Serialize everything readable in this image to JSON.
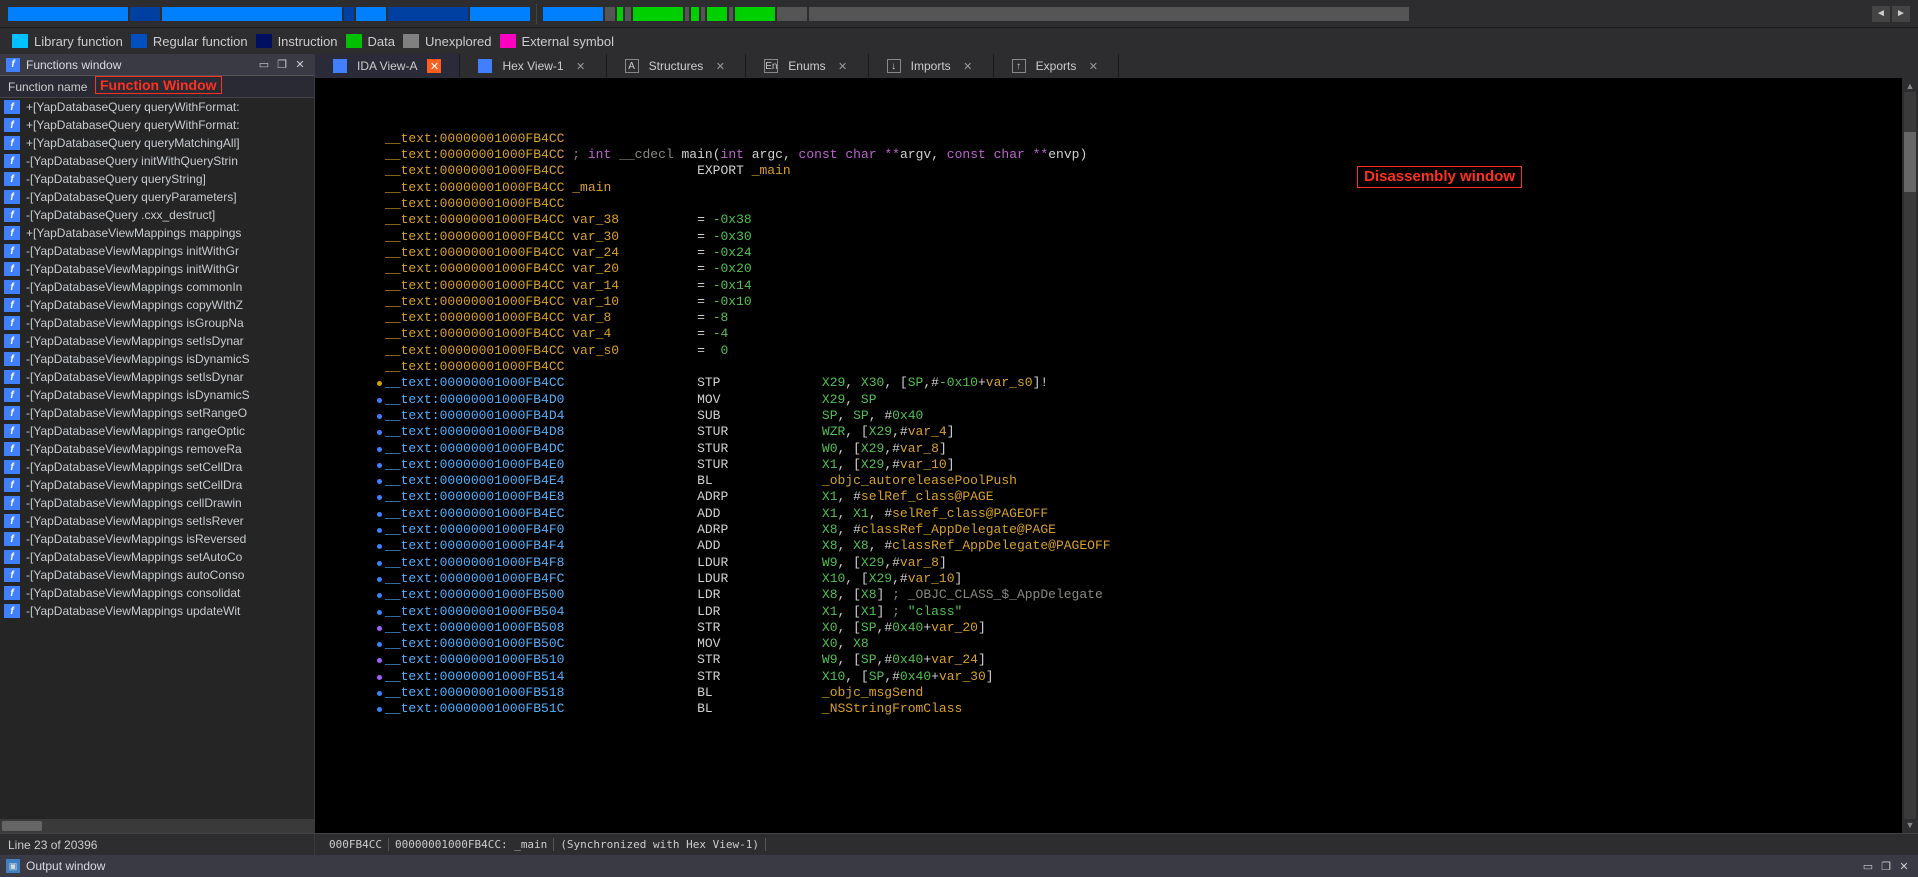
{
  "legend": [
    {
      "label": "Library function",
      "cls": "lg-cyan"
    },
    {
      "label": "Regular function",
      "cls": "lg-blue"
    },
    {
      "label": "Instruction",
      "cls": "lg-dblue"
    },
    {
      "label": "Data",
      "cls": "lg-green"
    },
    {
      "label": "Unexplored",
      "cls": "lg-gray"
    },
    {
      "label": "External symbol",
      "cls": "lg-pink"
    }
  ],
  "panels": {
    "functions_title": "Functions window",
    "output_title": "Output window",
    "function_window_annotation": "Function Window",
    "disasm_annotation": "Disassembly window",
    "column_header": "Function name"
  },
  "tabs": [
    {
      "label": "IDA View-A",
      "active": true,
      "icon": "ticon-blue",
      "close": "orange"
    },
    {
      "label": "Hex View-1",
      "active": false,
      "icon": "ticon-blue",
      "close": ""
    },
    {
      "label": "Structures",
      "active": false,
      "icon": "ticon-box",
      "iconText": "A",
      "close": ""
    },
    {
      "label": "Enums",
      "active": false,
      "icon": "ticon-box",
      "iconText": "En",
      "close": ""
    },
    {
      "label": "Imports",
      "active": false,
      "icon": "ticon-box",
      "iconText": "↓",
      "close": ""
    },
    {
      "label": "Exports",
      "active": false,
      "icon": "ticon-box",
      "iconText": "↑",
      "close": ""
    }
  ],
  "functions": [
    "+[YapDatabaseQuery queryWithFormat:",
    "+[YapDatabaseQuery queryWithFormat:",
    "+[YapDatabaseQuery queryMatchingAll]",
    "-[YapDatabaseQuery initWithQueryStrin",
    "-[YapDatabaseQuery queryString]",
    "-[YapDatabaseQuery queryParameters]",
    "-[YapDatabaseQuery .cxx_destruct]",
    "+[YapDatabaseViewMappings mappings",
    "-[YapDatabaseViewMappings initWithGr",
    "-[YapDatabaseViewMappings initWithGr",
    "-[YapDatabaseViewMappings commonIn",
    "-[YapDatabaseViewMappings copyWithZ",
    "-[YapDatabaseViewMappings isGroupNa",
    "-[YapDatabaseViewMappings setIsDynar",
    "-[YapDatabaseViewMappings isDynamicS",
    "-[YapDatabaseViewMappings setIsDynar",
    "-[YapDatabaseViewMappings isDynamicS",
    "-[YapDatabaseViewMappings setRangeO",
    "-[YapDatabaseViewMappings rangeOptic",
    "-[YapDatabaseViewMappings removeRa",
    "-[YapDatabaseViewMappings setCellDra",
    "-[YapDatabaseViewMappings setCellDra",
    "-[YapDatabaseViewMappings cellDrawin",
    "-[YapDatabaseViewMappings setIsRever",
    "-[YapDatabaseViewMappings isReversed",
    "-[YapDatabaseViewMappings setAutoCo",
    "-[YapDatabaseViewMappings autoConso",
    "-[YapDatabaseViewMappings consolidat",
    "-[YapDatabaseViewMappings updateWit"
  ],
  "status": {
    "left": "Line 23 of 20396",
    "right_cells": [
      "000FB4CC",
      "00000001000FB4CC: _main",
      "(Synchronized with Hex View-1)"
    ]
  },
  "disasm": [
    {
      "dot": "",
      "addr": "__text:00000001000FB4CC",
      "rest": ""
    },
    {
      "dot": "",
      "addr": "__text:00000001000FB4CC",
      "sig": "; int __cdecl main(int argc, const char **argv, const char **envp)"
    },
    {
      "dot": "",
      "addr": "__text:00000001000FB4CC",
      "export": "EXPORT _main"
    },
    {
      "dot": "",
      "addr": "__text:00000001000FB4CC",
      "label": "_main"
    },
    {
      "dot": "",
      "addr": "__text:00000001000FB4CC",
      "rest": ""
    },
    {
      "dot": "",
      "addr": "__text:00000001000FB4CC",
      "var": "var_38",
      "eq": "-0x38"
    },
    {
      "dot": "",
      "addr": "__text:00000001000FB4CC",
      "var": "var_30",
      "eq": "-0x30"
    },
    {
      "dot": "",
      "addr": "__text:00000001000FB4CC",
      "var": "var_24",
      "eq": "-0x24"
    },
    {
      "dot": "",
      "addr": "__text:00000001000FB4CC",
      "var": "var_20",
      "eq": "-0x20"
    },
    {
      "dot": "",
      "addr": "__text:00000001000FB4CC",
      "var": "var_14",
      "eq": "-0x14"
    },
    {
      "dot": "",
      "addr": "__text:00000001000FB4CC",
      "var": "var_10",
      "eq": "-0x10"
    },
    {
      "dot": "",
      "addr": "__text:00000001000FB4CC",
      "var": "var_8",
      "eq": "-8"
    },
    {
      "dot": "",
      "addr": "__text:00000001000FB4CC",
      "var": "var_4",
      "eq": "-4"
    },
    {
      "dot": "",
      "addr": "__text:00000001000FB4CC",
      "var": "var_s0",
      "eq": " 0"
    },
    {
      "dot": "",
      "addr": "__text:00000001000FB4CC",
      "rest": ""
    },
    {
      "dot": "y",
      "addrb": "__text:00000001000FB4CC",
      "mn": "STP",
      "ops": [
        {
          "t": "reg",
          "v": "X29"
        },
        {
          "t": "p",
          "v": ", "
        },
        {
          "t": "reg",
          "v": "X30"
        },
        {
          "t": "p",
          "v": ", ["
        },
        {
          "t": "reg",
          "v": "SP"
        },
        {
          "t": "p",
          "v": ",#"
        },
        {
          "t": "num",
          "v": "-0x10"
        },
        {
          "t": "p",
          "v": "+"
        },
        {
          "t": "varref",
          "v": "var_s0"
        },
        {
          "t": "p",
          "v": "]!"
        }
      ]
    },
    {
      "dot": "b",
      "addrb": "__text:00000001000FB4D0",
      "mn": "MOV",
      "ops": [
        {
          "t": "reg",
          "v": "X29"
        },
        {
          "t": "p",
          "v": ", "
        },
        {
          "t": "reg",
          "v": "SP"
        }
      ]
    },
    {
      "dot": "b",
      "addrb": "__text:00000001000FB4D4",
      "mn": "SUB",
      "ops": [
        {
          "t": "reg",
          "v": "SP"
        },
        {
          "t": "p",
          "v": ", "
        },
        {
          "t": "reg",
          "v": "SP"
        },
        {
          "t": "p",
          "v": ", #"
        },
        {
          "t": "num",
          "v": "0x40"
        }
      ]
    },
    {
      "dot": "b",
      "addrb": "__text:00000001000FB4D8",
      "mn": "STUR",
      "ops": [
        {
          "t": "reg",
          "v": "WZR"
        },
        {
          "t": "p",
          "v": ", ["
        },
        {
          "t": "reg",
          "v": "X29"
        },
        {
          "t": "p",
          "v": ",#"
        },
        {
          "t": "varref",
          "v": "var_4"
        },
        {
          "t": "p",
          "v": "]"
        }
      ]
    },
    {
      "dot": "b",
      "addrb": "__text:00000001000FB4DC",
      "mn": "STUR",
      "ops": [
        {
          "t": "reg",
          "v": "W0"
        },
        {
          "t": "p",
          "v": ", ["
        },
        {
          "t": "reg",
          "v": "X29"
        },
        {
          "t": "p",
          "v": ",#"
        },
        {
          "t": "varref",
          "v": "var_8"
        },
        {
          "t": "p",
          "v": "]"
        }
      ]
    },
    {
      "dot": "b",
      "addrb": "__text:00000001000FB4E0",
      "mn": "STUR",
      "ops": [
        {
          "t": "reg",
          "v": "X1"
        },
        {
          "t": "p",
          "v": ", ["
        },
        {
          "t": "reg",
          "v": "X29"
        },
        {
          "t": "p",
          "v": ",#"
        },
        {
          "t": "varref",
          "v": "var_10"
        },
        {
          "t": "p",
          "v": "]"
        }
      ]
    },
    {
      "dot": "b",
      "addrb": "__text:00000001000FB4E4",
      "mn": "BL",
      "ops": [
        {
          "t": "call",
          "v": "_objc_autoreleasePoolPush"
        }
      ]
    },
    {
      "dot": "b",
      "addrb": "__text:00000001000FB4E8",
      "mn": "ADRP",
      "ops": [
        {
          "t": "reg",
          "v": "X1"
        },
        {
          "t": "p",
          "v": ", #"
        },
        {
          "t": "call",
          "v": "selRef_class@PAGE"
        }
      ]
    },
    {
      "dot": "b",
      "addrb": "__text:00000001000FB4EC",
      "mn": "ADD",
      "ops": [
        {
          "t": "reg",
          "v": "X1"
        },
        {
          "t": "p",
          "v": ", "
        },
        {
          "t": "reg",
          "v": "X1"
        },
        {
          "t": "p",
          "v": ", #"
        },
        {
          "t": "call",
          "v": "selRef_class@PAGEOFF"
        }
      ]
    },
    {
      "dot": "b",
      "addrb": "__text:00000001000FB4F0",
      "mn": "ADRP",
      "ops": [
        {
          "t": "reg",
          "v": "X8"
        },
        {
          "t": "p",
          "v": ", #"
        },
        {
          "t": "call",
          "v": "classRef_AppDelegate@PAGE"
        }
      ]
    },
    {
      "dot": "b",
      "addrb": "__text:00000001000FB4F4",
      "mn": "ADD",
      "ops": [
        {
          "t": "reg",
          "v": "X8"
        },
        {
          "t": "p",
          "v": ", "
        },
        {
          "t": "reg",
          "v": "X8"
        },
        {
          "t": "p",
          "v": ", #"
        },
        {
          "t": "call",
          "v": "classRef_AppDelegate@PAGEOFF"
        }
      ]
    },
    {
      "dot": "b",
      "addrb": "__text:00000001000FB4F8",
      "mn": "LDUR",
      "ops": [
        {
          "t": "reg",
          "v": "W9"
        },
        {
          "t": "p",
          "v": ", ["
        },
        {
          "t": "reg",
          "v": "X29"
        },
        {
          "t": "p",
          "v": ",#"
        },
        {
          "t": "varref",
          "v": "var_8"
        },
        {
          "t": "p",
          "v": "]"
        }
      ]
    },
    {
      "dot": "b",
      "addrb": "__text:00000001000FB4FC",
      "mn": "LDUR",
      "ops": [
        {
          "t": "reg",
          "v": "X10"
        },
        {
          "t": "p",
          "v": ", ["
        },
        {
          "t": "reg",
          "v": "X29"
        },
        {
          "t": "p",
          "v": ",#"
        },
        {
          "t": "varref",
          "v": "var_10"
        },
        {
          "t": "p",
          "v": "]"
        }
      ]
    },
    {
      "dot": "b",
      "addrb": "__text:00000001000FB500",
      "mn": "LDR",
      "ops": [
        {
          "t": "reg",
          "v": "X8"
        },
        {
          "t": "p",
          "v": ", ["
        },
        {
          "t": "reg",
          "v": "X8"
        },
        {
          "t": "p",
          "v": "] "
        },
        {
          "t": "cmt",
          "v": "; _OBJC_CLASS_$_AppDelegate"
        }
      ]
    },
    {
      "dot": "b",
      "addrb": "__text:00000001000FB504",
      "mn": "LDR",
      "ops": [
        {
          "t": "reg",
          "v": "X1"
        },
        {
          "t": "p",
          "v": ", ["
        },
        {
          "t": "reg",
          "v": "X1"
        },
        {
          "t": "p",
          "v": "] "
        },
        {
          "t": "cmt",
          "v": "; "
        },
        {
          "t": "str",
          "v": "\"class\""
        }
      ]
    },
    {
      "dot": "p",
      "addrb": "__text:00000001000FB508",
      "mn": "STR",
      "ops": [
        {
          "t": "reg",
          "v": "X0"
        },
        {
          "t": "p",
          "v": ", ["
        },
        {
          "t": "reg",
          "v": "SP"
        },
        {
          "t": "p",
          "v": ",#"
        },
        {
          "t": "num",
          "v": "0x40"
        },
        {
          "t": "p",
          "v": "+"
        },
        {
          "t": "varref",
          "v": "var_20"
        },
        {
          "t": "p",
          "v": "]"
        }
      ]
    },
    {
      "dot": "b",
      "addrb": "__text:00000001000FB50C",
      "mn": "MOV",
      "ops": [
        {
          "t": "reg",
          "v": "X0"
        },
        {
          "t": "p",
          "v": ", "
        },
        {
          "t": "reg",
          "v": "X8"
        }
      ]
    },
    {
      "dot": "p",
      "addrb": "__text:00000001000FB510",
      "mn": "STR",
      "ops": [
        {
          "t": "reg",
          "v": "W9"
        },
        {
          "t": "p",
          "v": ", ["
        },
        {
          "t": "reg",
          "v": "SP"
        },
        {
          "t": "p",
          "v": ",#"
        },
        {
          "t": "num",
          "v": "0x40"
        },
        {
          "t": "p",
          "v": "+"
        },
        {
          "t": "varref",
          "v": "var_24"
        },
        {
          "t": "p",
          "v": "]"
        }
      ]
    },
    {
      "dot": "p",
      "addrb": "__text:00000001000FB514",
      "mn": "STR",
      "ops": [
        {
          "t": "reg",
          "v": "X10"
        },
        {
          "t": "p",
          "v": ", ["
        },
        {
          "t": "reg",
          "v": "SP"
        },
        {
          "t": "p",
          "v": ",#"
        },
        {
          "t": "num",
          "v": "0x40"
        },
        {
          "t": "p",
          "v": "+"
        },
        {
          "t": "varref",
          "v": "var_30"
        },
        {
          "t": "p",
          "v": "]"
        }
      ]
    },
    {
      "dot": "b",
      "addrb": "__text:00000001000FB518",
      "mn": "BL",
      "ops": [
        {
          "t": "call",
          "v": "_objc_msgSend"
        }
      ]
    },
    {
      "dot": "b",
      "addrb": "__text:00000001000FB51C",
      "mn": "BL",
      "ops": [
        {
          "t": "call",
          "v": "_NSStringFromClass"
        }
      ]
    }
  ]
}
